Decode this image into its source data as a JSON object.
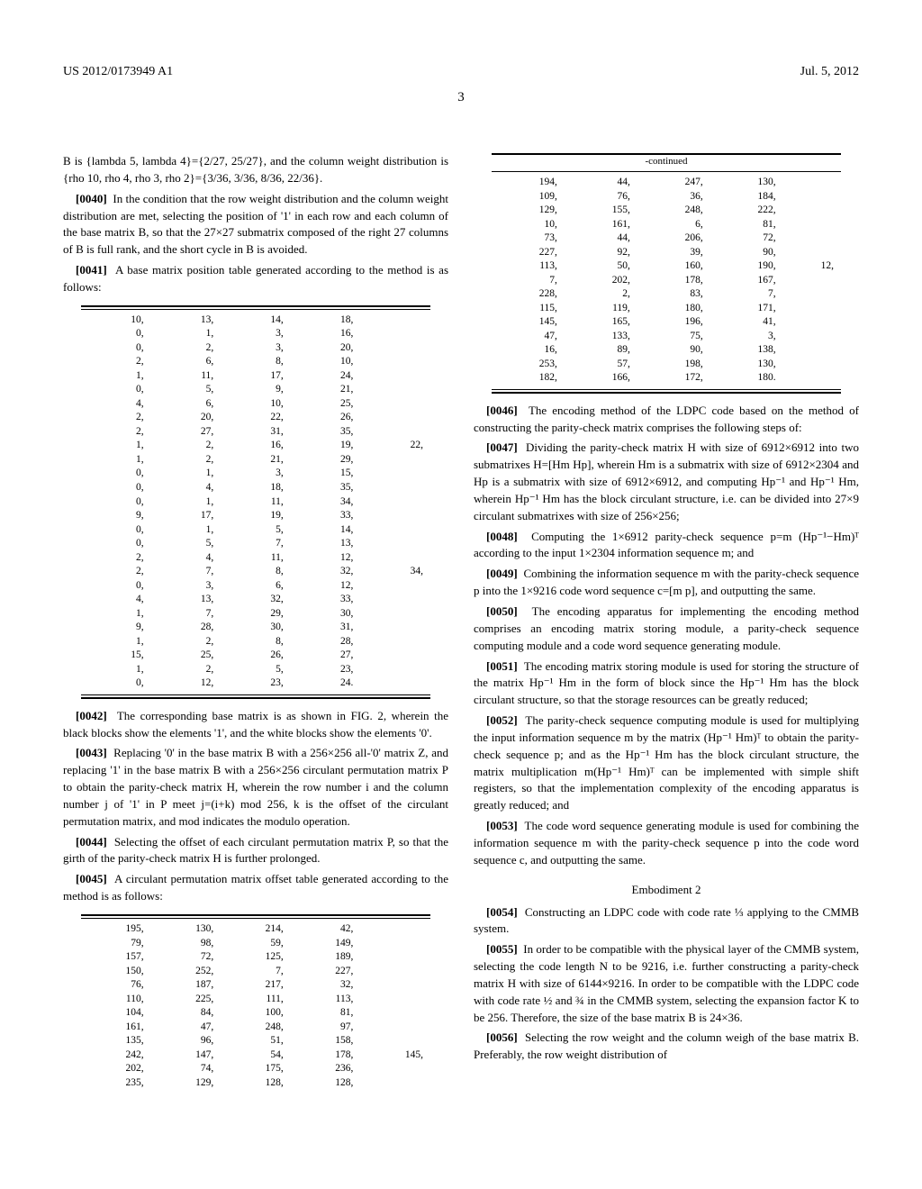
{
  "header": {
    "pub_no": "US 2012/0173949 A1",
    "date": "Jul. 5, 2012",
    "page_num": "3"
  },
  "left": {
    "p_intro": "B is {lambda 5, lambda 4}={2/27, 25/27}, and the column weight distribution is {rho 10, rho 4, rho 3, rho 2}={3/36, 3/36, 8/36, 22/36}.",
    "p0040": "In the condition that the row weight distribution and the column weight distribution are met, selecting the position of '1' in each row and each column of the base matrix B, so that the 27×27 submatrix composed of the right 27 columns of B is full rank, and the short cycle in B is avoided.",
    "p0041": "A base matrix position table generated according to the method is as follows:",
    "table1": [
      [
        "10,",
        "13,",
        "14,",
        "18,",
        ""
      ],
      [
        "0,",
        "1,",
        "3,",
        "16,",
        ""
      ],
      [
        "0,",
        "2,",
        "3,",
        "20,",
        ""
      ],
      [
        "2,",
        "6,",
        "8,",
        "10,",
        ""
      ],
      [
        "1,",
        "11,",
        "17,",
        "24,",
        ""
      ],
      [
        "0,",
        "5,",
        "9,",
        "21,",
        ""
      ],
      [
        "4,",
        "6,",
        "10,",
        "25,",
        ""
      ],
      [
        "2,",
        "20,",
        "22,",
        "26,",
        ""
      ],
      [
        "2,",
        "27,",
        "31,",
        "35,",
        ""
      ],
      [
        "1,",
        "2,",
        "16,",
        "19,",
        "22,"
      ],
      [
        "1,",
        "2,",
        "21,",
        "29,",
        ""
      ],
      [
        "0,",
        "1,",
        "3,",
        "15,",
        ""
      ],
      [
        "0,",
        "4,",
        "18,",
        "35,",
        ""
      ],
      [
        "0,",
        "1,",
        "11,",
        "34,",
        ""
      ],
      [
        "9,",
        "17,",
        "19,",
        "33,",
        ""
      ],
      [
        "0,",
        "1,",
        "5,",
        "14,",
        ""
      ],
      [
        "0,",
        "5,",
        "7,",
        "13,",
        ""
      ],
      [
        "2,",
        "4,",
        "11,",
        "12,",
        ""
      ],
      [
        "2,",
        "7,",
        "8,",
        "32,",
        "34,"
      ],
      [
        "0,",
        "3,",
        "6,",
        "12,",
        ""
      ],
      [
        "4,",
        "13,",
        "32,",
        "33,",
        ""
      ],
      [
        "1,",
        "7,",
        "29,",
        "30,",
        ""
      ],
      [
        "9,",
        "28,",
        "30,",
        "31,",
        ""
      ],
      [
        "1,",
        "2,",
        "8,",
        "28,",
        ""
      ],
      [
        "15,",
        "25,",
        "26,",
        "27,",
        ""
      ],
      [
        "1,",
        "2,",
        "5,",
        "23,",
        ""
      ],
      [
        "0,",
        "12,",
        "23,",
        "24.",
        ""
      ]
    ],
    "p0042": "The corresponding base matrix is as shown in FIG. 2, wherein the black blocks show the elements '1', and the white blocks show the elements '0'.",
    "p0043": "Replacing '0' in the base matrix B with a 256×256 all-'0' matrix Z, and replacing '1' in the base matrix B with a 256×256 circulant permutation matrix P to obtain the parity-check matrix H, wherein the row number i and the column number j of '1' in P meet j=(i+k) mod 256, k is the offset of the circulant permutation matrix, and mod indicates the modulo operation.",
    "p0044": "Selecting the offset of each circulant permutation matrix P, so that the girth of the parity-check matrix H is further prolonged.",
    "p0045": "A circulant permutation matrix offset table generated according to the method is as follows:",
    "table2a": [
      [
        "195,",
        "130,",
        "214,",
        "42,",
        ""
      ],
      [
        "79,",
        "98,",
        "59,",
        "149,",
        ""
      ],
      [
        "157,",
        "72,",
        "125,",
        "189,",
        ""
      ],
      [
        "150,",
        "252,",
        "7,",
        "227,",
        ""
      ],
      [
        "76,",
        "187,",
        "217,",
        "32,",
        ""
      ],
      [
        "110,",
        "225,",
        "111,",
        "113,",
        ""
      ],
      [
        "104,",
        "84,",
        "100,",
        "81,",
        ""
      ],
      [
        "161,",
        "47,",
        "248,",
        "97,",
        ""
      ],
      [
        "135,",
        "96,",
        "51,",
        "158,",
        ""
      ],
      [
        "242,",
        "147,",
        "54,",
        "178,",
        "145,"
      ],
      [
        "202,",
        "74,",
        "175,",
        "236,",
        ""
      ],
      [
        "235,",
        "129,",
        "128,",
        "128,",
        ""
      ]
    ]
  },
  "right": {
    "table2b_label": "-continued",
    "table2b": [
      [
        "194,",
        "44,",
        "247,",
        "130,",
        ""
      ],
      [
        "109,",
        "76,",
        "36,",
        "184,",
        ""
      ],
      [
        "129,",
        "155,",
        "248,",
        "222,",
        ""
      ],
      [
        "10,",
        "161,",
        "6,",
        "81,",
        ""
      ],
      [
        "73,",
        "44,",
        "206,",
        "72,",
        ""
      ],
      [
        "227,",
        "92,",
        "39,",
        "90,",
        ""
      ],
      [
        "113,",
        "50,",
        "160,",
        "190,",
        "12,"
      ],
      [
        "7,",
        "202,",
        "178,",
        "167,",
        ""
      ],
      [
        "228,",
        "2,",
        "83,",
        "7,",
        ""
      ],
      [
        "115,",
        "119,",
        "180,",
        "171,",
        ""
      ],
      [
        "145,",
        "165,",
        "196,",
        "41,",
        ""
      ],
      [
        "47,",
        "133,",
        "75,",
        "3,",
        ""
      ],
      [
        "16,",
        "89,",
        "90,",
        "138,",
        ""
      ],
      [
        "253,",
        "57,",
        "198,",
        "130,",
        ""
      ],
      [
        "182,",
        "166,",
        "172,",
        "180.",
        ""
      ]
    ],
    "p0046": "The encoding method of the LDPC code based on the method of constructing the parity-check matrix comprises the following steps of:",
    "p0047": "Dividing the parity-check matrix H with size of 6912×6912 into two submatrixes H=[Hm Hp], wherein Hm is a submatrix with size of 6912×2304 and Hp is a submatrix with size of 6912×6912, and computing Hp⁻¹ and Hp⁻¹ Hm, wherein Hp⁻¹ Hm has the block circulant structure, i.e. can be divided into 27×9 circulant submatrixes with size of 256×256;",
    "p0048": "Computing the 1×6912 parity-check sequence p=m (Hp⁻¹−Hm)ᵀ according to the input 1×2304 information sequence m; and",
    "p0049": "Combining the information sequence m with the parity-check sequence p into the 1×9216 code word sequence c=[m p], and outputting the same.",
    "p0050": "The encoding apparatus for implementing the encoding method comprises an encoding matrix storing module, a parity-check sequence computing module and a code word sequence generating module.",
    "p0051": "The encoding matrix storing module is used for storing the structure of the matrix Hp⁻¹ Hm in the form of block since the Hp⁻¹ Hm has the block circulant structure, so that the storage resources can be greatly reduced;",
    "p0052": "The parity-check sequence computing module is used for multiplying the input information sequence m by the matrix (Hp⁻¹ Hm)ᵀ to obtain the parity-check sequence p; and as the Hp⁻¹ Hm has the block circulant structure, the matrix multiplication m(Hp⁻¹ Hm)ᵀ can be implemented with simple shift registers, so that the implementation complexity of the encoding apparatus is greatly reduced; and",
    "p0053": "The code word sequence generating module is used for combining the information sequence m with the parity-check sequence p into the code word sequence c, and outputting the same.",
    "emb2_title": "Embodiment 2",
    "p0054": "Constructing an LDPC code with code rate ⅓ applying to the CMMB system.",
    "p0055": "In order to be compatible with the physical layer of the CMMB system, selecting the code length N to be 9216, i.e. further constructing a parity-check matrix H with size of 6144×9216. In order to be compatible with the LDPC code with code rate ½ and ¾ in the CMMB system, selecting the expansion factor K to be 256. Therefore, the size of the base matrix B is 24×36.",
    "p0056": "Selecting the row weight and the column weigh of the base matrix B. Preferably, the row weight distribution of"
  }
}
